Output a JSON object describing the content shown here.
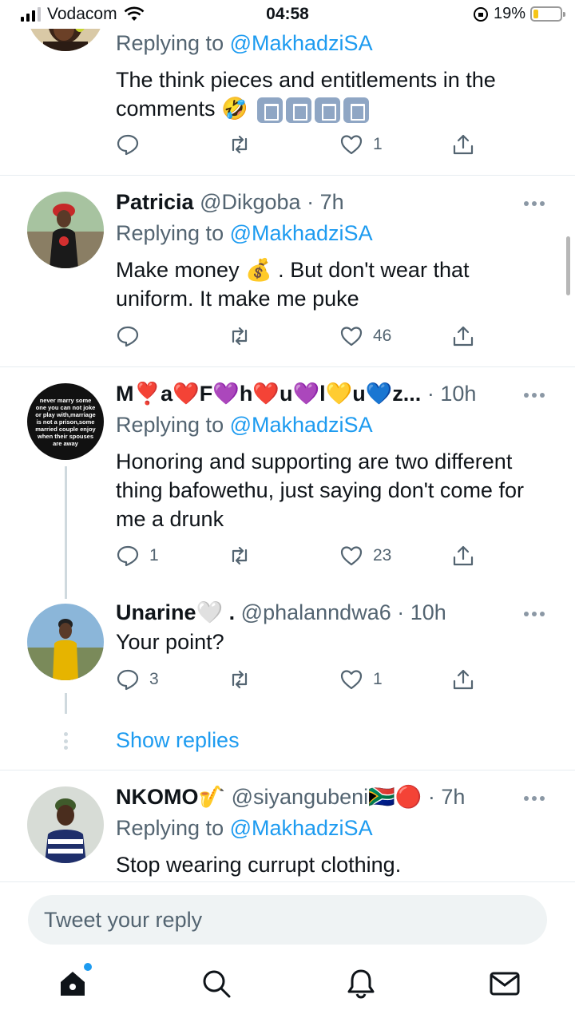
{
  "status_bar": {
    "carrier": "Vodacom",
    "time": "04:58",
    "battery": "19%",
    "battery_level": 0.19
  },
  "tweets": [
    {
      "replying_prefix": "Replying to ",
      "replying_to": "@MakhadziSA",
      "text": "The think pieces and entitlements in the comments 🤣",
      "counts": {
        "reply": "",
        "retweet": "",
        "like": "1"
      }
    },
    {
      "name": "Patricia",
      "handle": "@Dikgoba",
      "time": "· 7h",
      "replying_prefix": "Replying to ",
      "replying_to": "@MakhadziSA",
      "text_line1": "Make money 💰 .  But don't wear that",
      "text_line2": "uniform.  It make me puke",
      "counts": {
        "reply": "",
        "retweet": "",
        "like": "46"
      }
    },
    {
      "name": "M❣️a❤️F💜h❤️u💜l💛u💙z...",
      "time": "· 10h",
      "replying_prefix": "Replying to ",
      "replying_to": "@MakhadziSA",
      "text": "Honoring and supporting are two different thing bafowethu, just saying don't come for me a drunk",
      "avatar_text": "never marry some one you can not joke or play with,marriage is not a prison,some married couple enjoy when their spouses are away",
      "counts": {
        "reply": "1",
        "retweet": "",
        "like": "23"
      }
    },
    {
      "name": "Unarine🤍 .",
      "handle": "@phalanndwa6",
      "time": "· 10h",
      "text": "Your point?",
      "counts": {
        "reply": "3",
        "retweet": "",
        "like": "1"
      }
    },
    {
      "name": "NKOMO🎷",
      "handle": "@siyangubeni🇿🇦🔴",
      "time": "· 7h",
      "replying_prefix": "Replying to ",
      "replying_to": "@MakhadziSA",
      "text": "Stop wearing currupt clothing."
    }
  ],
  "show_replies": "Show replies",
  "reply_placeholder": "Tweet your reply",
  "colors": {
    "accent": "#1d9bf0",
    "muted": "#536471",
    "text": "#0f1419"
  }
}
